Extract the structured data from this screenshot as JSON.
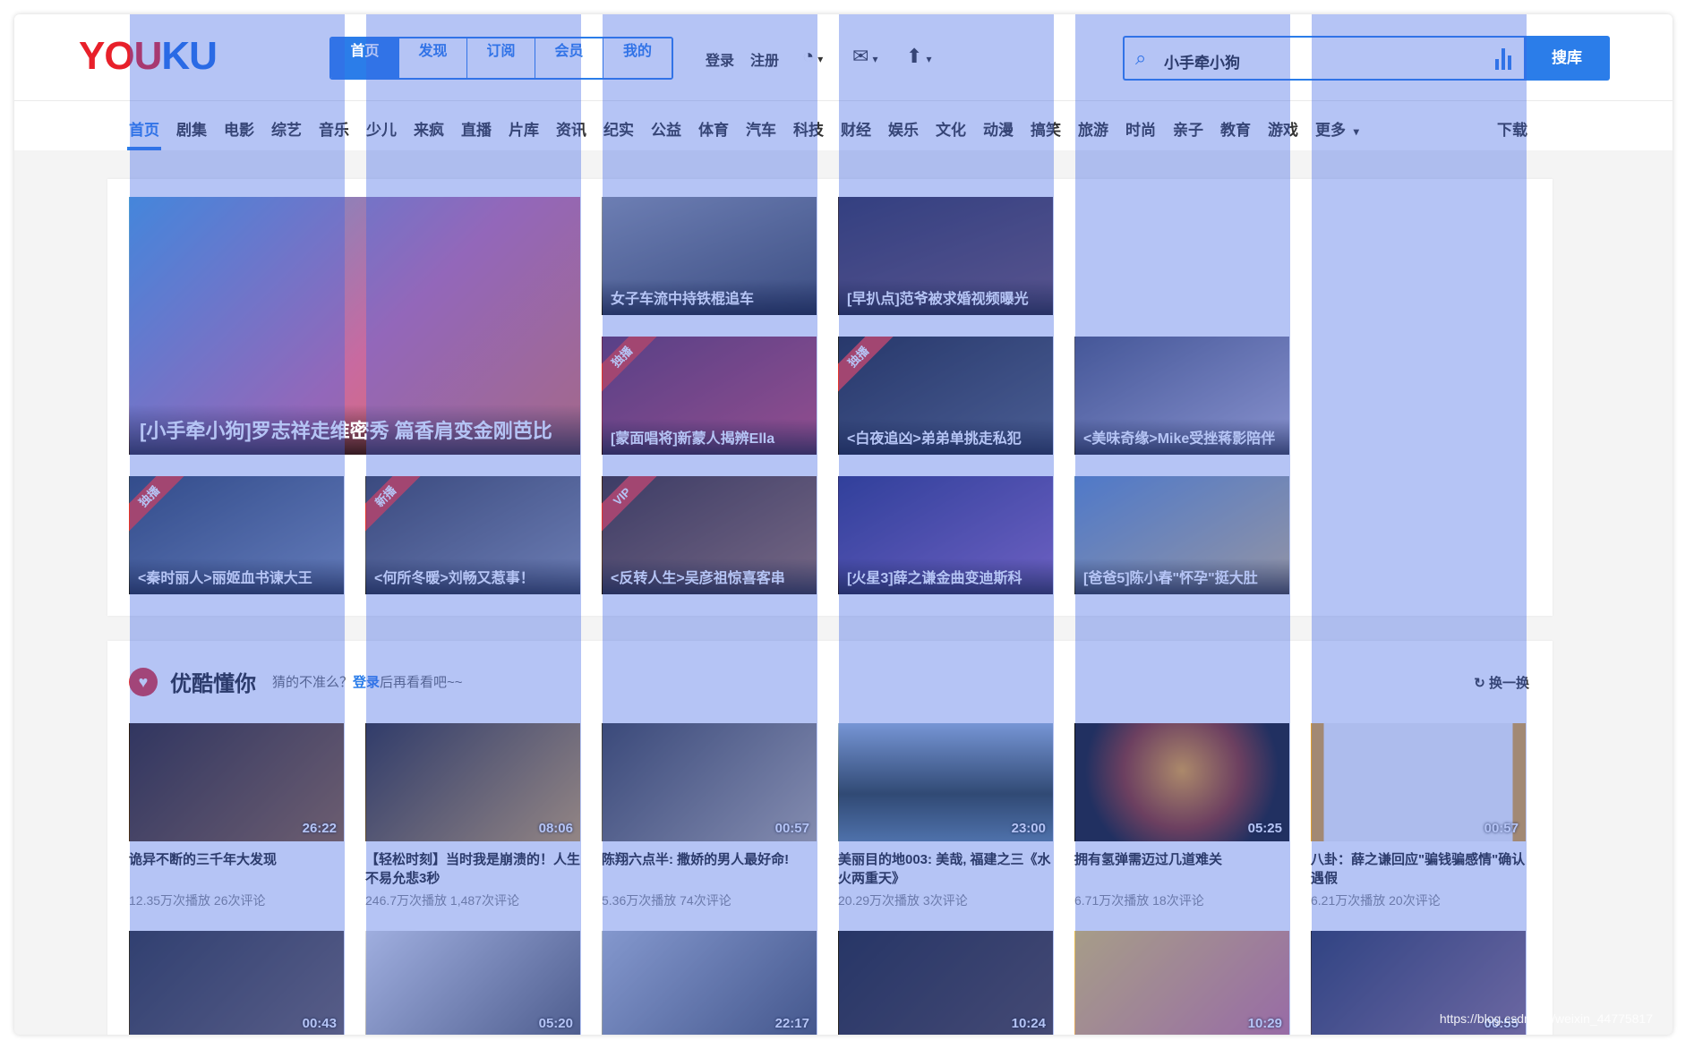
{
  "logo": {
    "part1": "YOU",
    "part2": "KU"
  },
  "main_tabs": [
    "首页",
    "发现",
    "订阅",
    "会员",
    "我的"
  ],
  "auth": {
    "login": "登录",
    "register": "注册"
  },
  "search": {
    "value": "小手牵小狗",
    "button": "搜库"
  },
  "categories": [
    "首页",
    "剧集",
    "电影",
    "综艺",
    "音乐",
    "少儿",
    "来疯",
    "直播",
    "片库",
    "资讯",
    "纪实",
    "公益",
    "体育",
    "汽车",
    "科技",
    "财经",
    "娱乐",
    "文化",
    "动漫",
    "搞笑",
    "旅游",
    "时尚",
    "亲子",
    "教育",
    "游戏",
    "更多"
  ],
  "download": "下载",
  "featured": {
    "big_caption": "[小手牵小狗]罗志祥走维密秀 篇香肩变金刚芭比",
    "tiles": [
      {
        "caption": "女子车流中持铁棍追车",
        "badge": ""
      },
      {
        "caption": "[早扒点]范爷被求婚视频曝光",
        "badge": ""
      },
      {
        "caption": "[蒙面唱将]新蒙人揭辨Ella",
        "badge": "独播"
      },
      {
        "caption": "<白夜追凶>弟弟单挑走私犯",
        "badge": "独播"
      },
      {
        "caption": "<美味奇缘>Mike受挫蒋影陪伴",
        "badge": ""
      },
      {
        "caption": "<秦时丽人>丽姬血书谏大王",
        "badge": "独播"
      },
      {
        "caption": "<何所冬暖>刘畅又惹事！",
        "badge": "新播"
      },
      {
        "caption": "<反转人生>吴彦祖惊喜客串",
        "badge": "VIP"
      },
      {
        "caption": "[火星3]薛之谦金曲变迪斯科",
        "badge": ""
      },
      {
        "caption": "[爸爸5]陈小春\"怀孕\"挺大肚",
        "badge": ""
      }
    ]
  },
  "recommend": {
    "title": "优酷懂你",
    "subtitle_pre": "猜的不准么？",
    "subtitle_link": "登录",
    "subtitle_post": "后再看看吧~~",
    "refresh": "换一换",
    "cards": [
      {
        "duration": "26:22",
        "title": "诡异不断的三千年大发现",
        "meta": "12.35万次播放  26次评论"
      },
      {
        "duration": "08:06",
        "title": "【轻松时刻】当时我是崩溃的！人生不易允悲3秒",
        "meta": "246.7万次播放  1,487次评论"
      },
      {
        "duration": "00:57",
        "title": "陈翔六点半: 撒娇的男人最好命!",
        "meta": "5.36万次播放  74次评论"
      },
      {
        "duration": "23:00",
        "title": "美丽目的地003: 美哉, 福建之三《水火两重天》",
        "meta": "20.29万次播放  3次评论"
      },
      {
        "duration": "05:25",
        "title": "拥有氢弹需迈过几道难关",
        "meta": "6.71万次播放  18次评论"
      },
      {
        "duration": "00:57",
        "title": "八卦：薛之谦回应\"骗钱骗感情\"确认遇假",
        "meta": "6.21万次播放  20次评论"
      }
    ],
    "cards_row2": [
      "00:43",
      "05:20",
      "22:17",
      "10:24",
      "10:29",
      "00:55"
    ]
  },
  "watermark": "https://blog.csdn.net/weixin_44775817",
  "colors": {
    "accent": "#2b7de9",
    "logo_red": "#e8202a",
    "badge_red": "#e0352b",
    "overlay": "rgba(60,100,230,.38)"
  }
}
